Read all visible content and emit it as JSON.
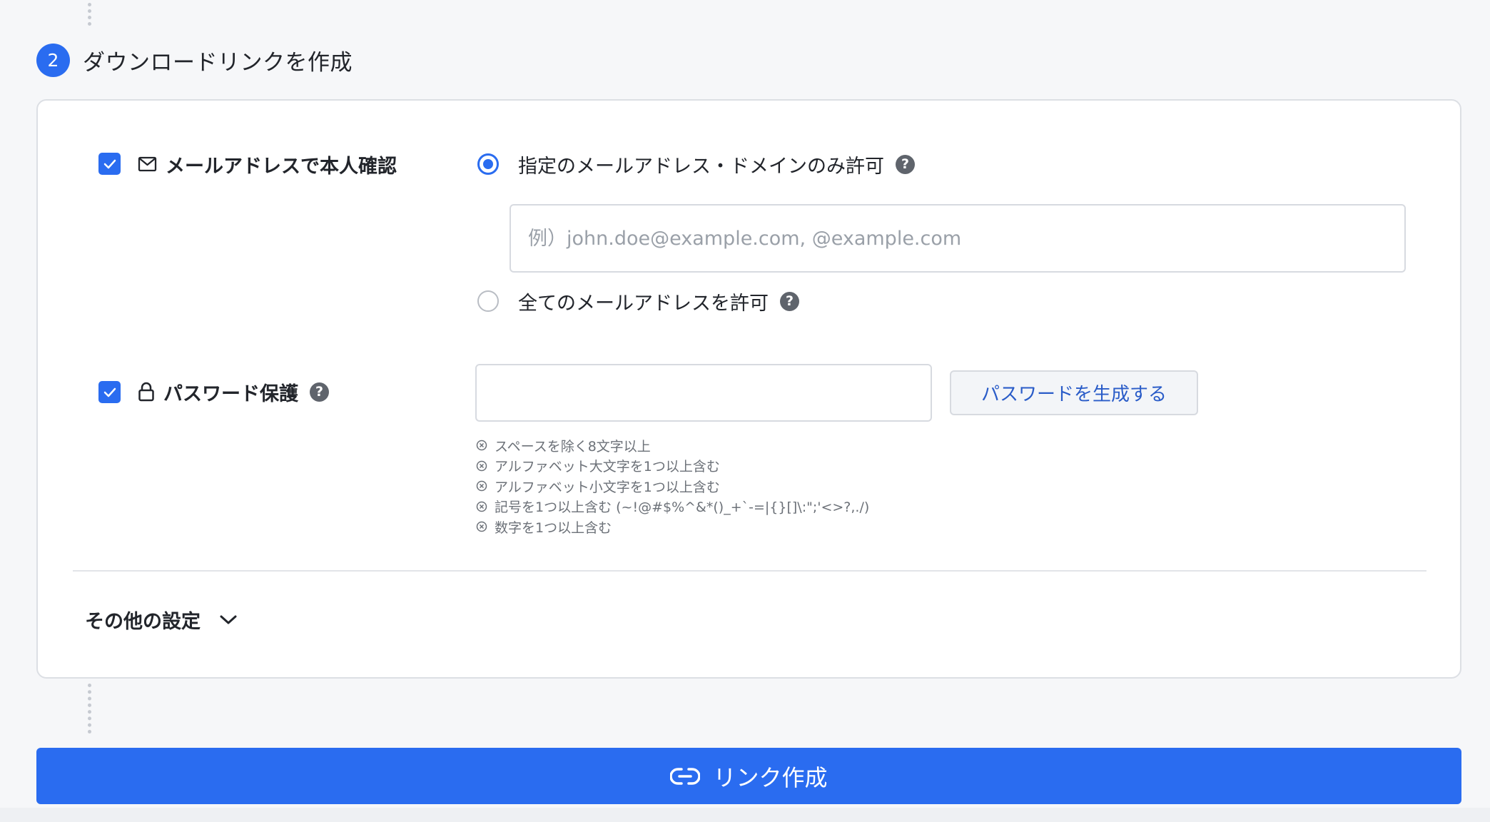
{
  "step": {
    "number": "2",
    "title": "ダウンロードリンクを作成"
  },
  "email_verification": {
    "label": "メールアドレスで本人確認",
    "checked": true,
    "icon": "mail-icon",
    "options": [
      {
        "label": "指定のメールアドレス・ドメインのみ許可",
        "selected": true
      },
      {
        "label": "全てのメールアドレスを許可",
        "selected": false
      }
    ],
    "input": {
      "value": "",
      "placeholder": "例）john.doe@example.com, @example.com"
    }
  },
  "password_protection": {
    "label": "パスワード保護",
    "checked": true,
    "icon": "lock-icon",
    "input": {
      "value": ""
    },
    "generate_label": "パスワードを生成する",
    "rules": [
      "スペースを除く8文字以上",
      "アルファベット大文字を1つ以上含む",
      "アルファベット小文字を1つ以上含む",
      "記号を1つ以上含む (~!@#$%^&*()_+`-=|{}[]\\:\";'<>?,./)",
      "数字を1つ以上含む"
    ]
  },
  "other_settings": {
    "label": "その他の設定"
  },
  "create_button": {
    "label": "リンク作成"
  },
  "colors": {
    "primary": "#2a6cf0",
    "background": "#f6f7f9",
    "card": "#ffffff",
    "text": "#22252b",
    "muted": "#6c7178"
  }
}
